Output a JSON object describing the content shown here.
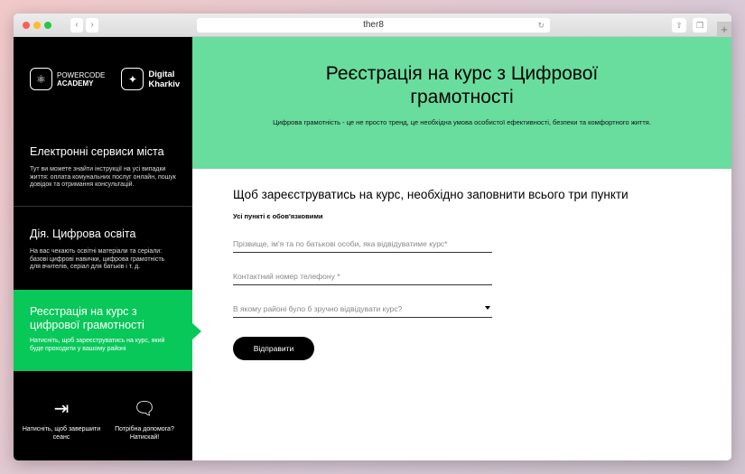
{
  "browser": {
    "url": "ther8"
  },
  "logos": {
    "powercode": "POWERCODE ACADEMY",
    "digital": "Digital Kharkiv"
  },
  "sidebar": {
    "items": [
      {
        "title": "Електронні сервиси міста",
        "desc": "Тут ви можете знайти інструкції на усі випадки життя: оплата комунальних послуг онлайн, пошук довідок та отримання консультацій."
      },
      {
        "title": "Дія. Цифрова освіта",
        "desc": "На вас чекають освітні матеріали та серіали: базові цифрові навички, цифрова грамотність для вчителів, серіал для батьків і т. д."
      },
      {
        "title": "Реєстрація на курс з цифрової грамотності",
        "desc": "Натисніть, щоб зареєструватись на курс, який буде проходити у вашому районі"
      }
    ],
    "logout": "Натисніть, щоб завершити сеанс",
    "help": "Потрібна допомога? Натискай!"
  },
  "hero": {
    "title": "Реєстрація на курс з Цифрової грамотності",
    "subtitle": "Цифрова грамотність  - це не просто тренд, це необхідна умова особистої ефективності,  безпеки та комфортного життя."
  },
  "form": {
    "heading": "Щоб зареєструватись на курс, необхідно заповнити всього три пункти",
    "required_note": "Усі пункті є обов'язковими",
    "name_placeholder": "Прізвище, ім'я та по батькові особи, яка відвідуватиме курс*",
    "phone_placeholder": "Контактний номер телефону *",
    "district_placeholder": "В якому районі було б зручно відвідувати курс?",
    "submit": "Відправити"
  },
  "colors": {
    "accent": "#08c85a",
    "hero": "#68dd9e"
  }
}
